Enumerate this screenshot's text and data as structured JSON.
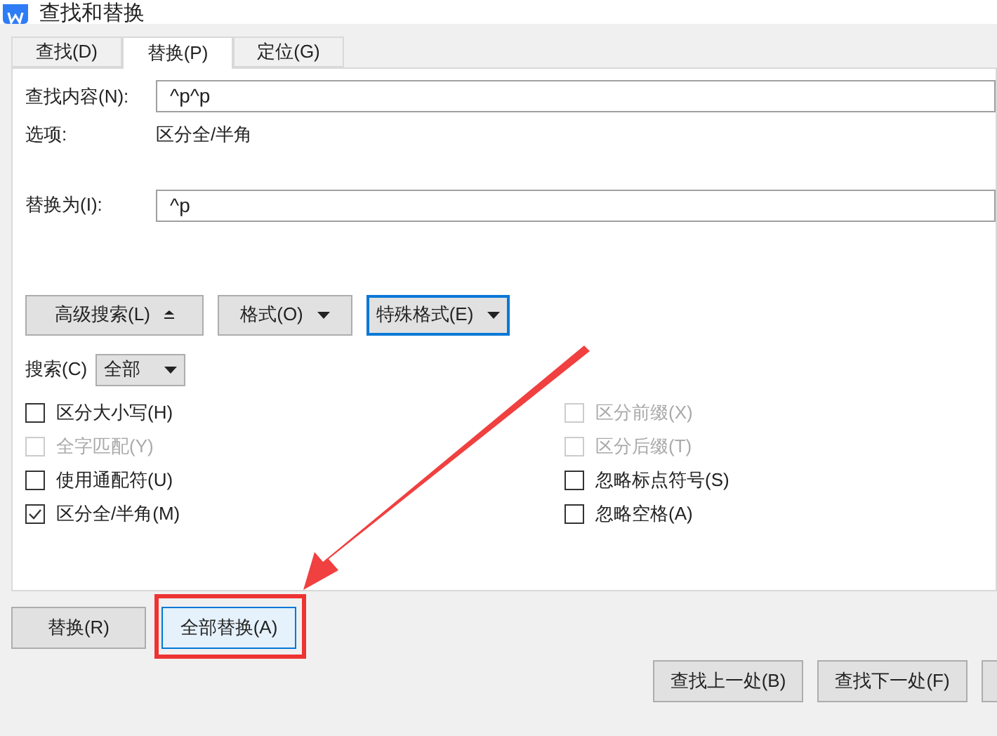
{
  "window": {
    "title": "查找和替换"
  },
  "tabs": [
    {
      "label": "查找(D)",
      "selected": false
    },
    {
      "label": "替换(P)",
      "selected": true
    },
    {
      "label": "定位(G)",
      "selected": false
    }
  ],
  "find": {
    "label": "查找内容(N):",
    "value": "^p^p"
  },
  "options": {
    "label": "选项:",
    "value": "区分全/半角"
  },
  "replace": {
    "label": "替换为(I):",
    "value": "^p"
  },
  "tool_buttons": [
    {
      "label": "高级搜索(L)",
      "kind": "collapse",
      "focused": false
    },
    {
      "label": "格式(O)",
      "kind": "dropdown",
      "focused": false
    },
    {
      "label": "特殊格式(E)",
      "kind": "dropdown",
      "focused": true
    }
  ],
  "search": {
    "label": "搜索(C)",
    "value": "全部"
  },
  "checkboxes_left": [
    {
      "label": "区分大小写(H)",
      "checked": false,
      "disabled": false
    },
    {
      "label": "全字匹配(Y)",
      "checked": false,
      "disabled": true
    },
    {
      "label": "使用通配符(U)",
      "checked": false,
      "disabled": false
    },
    {
      "label": "区分全/半角(M)",
      "checked": true,
      "disabled": false
    }
  ],
  "checkboxes_right": [
    {
      "label": "区分前缀(X)",
      "checked": false,
      "disabled": true
    },
    {
      "label": "区分后缀(T)",
      "checked": false,
      "disabled": true
    },
    {
      "label": "忽略标点符号(S)",
      "checked": false,
      "disabled": false
    },
    {
      "label": "忽略空格(A)",
      "checked": false,
      "disabled": false
    }
  ],
  "replace_buttons": [
    {
      "label": "替换(R)",
      "selected": false
    },
    {
      "label": "全部替换(A)",
      "selected": true
    }
  ],
  "nav_buttons": [
    "查找上一处(B)",
    "查找下一处(F)"
  ],
  "annotations": {
    "arrow": true,
    "highlight_box": true
  }
}
